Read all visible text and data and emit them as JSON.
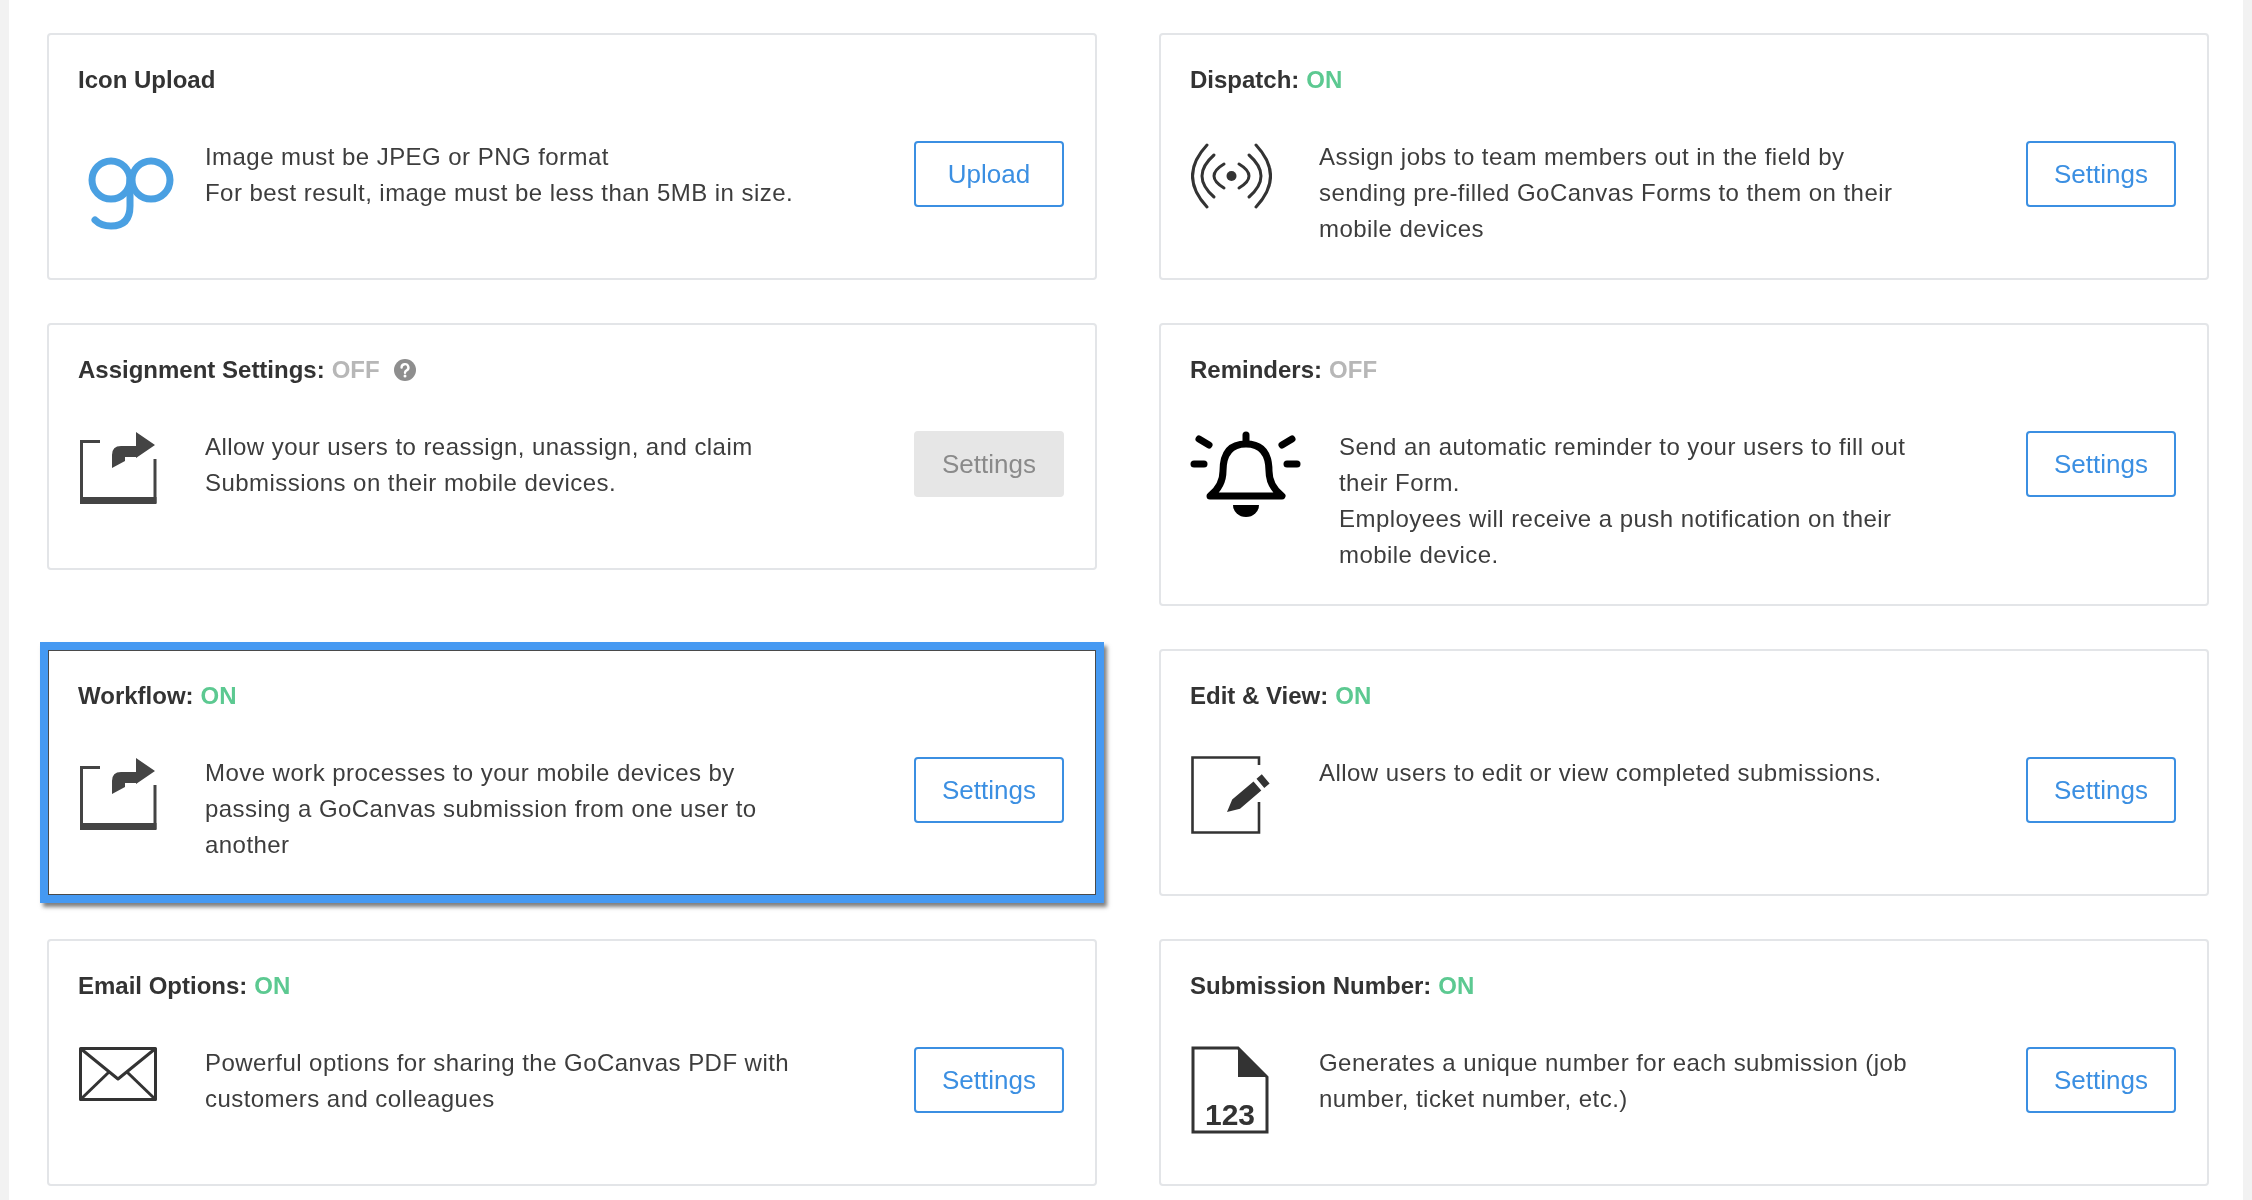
{
  "cards": [
    {
      "kind": "upload",
      "title": "Icon Upload",
      "help": false,
      "highlighted": false,
      "description": [
        "Image must be JPEG or PNG format",
        "For best result, image must be less than 5MB in size."
      ],
      "button": {
        "label": "Upload",
        "disabled": false
      }
    },
    {
      "kind": "dispatch",
      "title": "Dispatch:",
      "status": {
        "label": "ON",
        "on": true
      },
      "help": false,
      "highlighted": false,
      "description": [
        "Assign jobs to team members out in the field by sending pre-filled GoCanvas Forms to them on their mobile devices"
      ],
      "button": {
        "label": "Settings",
        "disabled": false
      }
    },
    {
      "kind": "assignment",
      "title": "Assignment Settings:",
      "status": {
        "label": "OFF",
        "on": false
      },
      "help": true,
      "highlighted": false,
      "description": [
        "Allow your users to reassign, unassign, and claim Submissions on their mobile devices."
      ],
      "button": {
        "label": "Settings",
        "disabled": true
      }
    },
    {
      "kind": "reminders",
      "title": "Reminders:",
      "status": {
        "label": "OFF",
        "on": false
      },
      "help": false,
      "highlighted": false,
      "description": [
        "Send an automatic reminder to your users to fill out their Form.",
        "Employees will receive a push notification on their mobile device."
      ],
      "button": {
        "label": "Settings",
        "disabled": false
      }
    },
    {
      "kind": "workflow",
      "title": "Workflow:",
      "status": {
        "label": "ON",
        "on": true
      },
      "help": false,
      "highlighted": true,
      "description": [
        "Move work processes to your mobile devices by passing a GoCanvas submission from one user to another"
      ],
      "button": {
        "label": "Settings",
        "disabled": false
      }
    },
    {
      "kind": "editing",
      "title": "Edit & View:",
      "status": {
        "label": "ON",
        "on": true
      },
      "help": false,
      "highlighted": false,
      "description": [
        "Allow users to edit or view completed submissions."
      ],
      "button": {
        "label": "Settings",
        "disabled": false
      }
    },
    {
      "kind": "email",
      "title": "Email Options:",
      "status": {
        "label": "ON",
        "on": true
      },
      "help": false,
      "highlighted": false,
      "description": [
        "Powerful options for sharing the GoCanvas PDF with customers and colleagues"
      ],
      "button": {
        "label": "Settings",
        "disabled": false
      }
    },
    {
      "kind": "numbering",
      "title": "Submission Number:",
      "status": {
        "label": "ON",
        "on": true
      },
      "help": false,
      "highlighted": false,
      "icon_label": "123",
      "description": [
        "Generates a unique number for each submission (job number, ticket number, etc.)"
      ],
      "button": {
        "label": "Settings",
        "disabled": false
      }
    }
  ]
}
